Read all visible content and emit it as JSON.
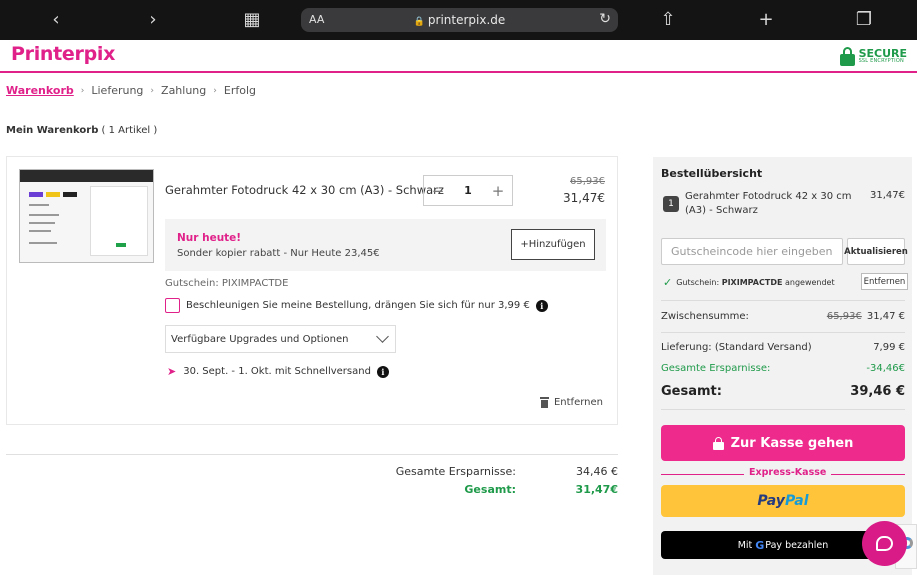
{
  "browser": {
    "aa_label": "AA",
    "url": "printerpix.de"
  },
  "header": {
    "logo": "Printerpix",
    "secure_main": "SECURE",
    "secure_sub": "SSL ENCRYPTION"
  },
  "breadcrumb": [
    "Warenkorb",
    "Lieferung",
    "Zahlung",
    "Erfolg"
  ],
  "cart": {
    "title": "Mein Warenkorb",
    "count": "( 1 Artikel )",
    "item": {
      "name": "Gerahmter Fotodruck 42 x 30 cm (A3) - Schwarz",
      "qty_minus": "−",
      "qty": "1",
      "qty_plus": "+",
      "price_old": "65,93€",
      "price_new": "31,47€"
    },
    "offer": {
      "title": "Nur heute!",
      "text": "Sonder kopier rabatt - Nur Heute 23,45€",
      "button": "+Hinzufügen"
    },
    "voucher": "Gutschein: PIXIMPACTDE",
    "express": "Beschleunigen Sie meine Bestellung, drängen Sie sich für nur 3,99 €",
    "upgrades": "Verfügbare Upgrades und Optionen",
    "delivery": "30. Sept. - 1. Okt. mit Schnellversand",
    "remove": "Entfernen"
  },
  "totals": {
    "savings_label": "Gesamte Ersparnisse:",
    "savings_value": "34,46 €",
    "total_label": "Gesamt:",
    "total_value": "31,47€"
  },
  "summary": {
    "title": "Bestellübersicht",
    "badge": "1",
    "item_name": "Gerahmter Fotodruck 42 x 30 cm (A3) - Schwarz",
    "item_price": "31,47€",
    "coupon_placeholder": "Gutscheincode hier eingeben",
    "coupon_button": "Aktualisieren",
    "coupon_applied_prefix": "Gutschein:",
    "coupon_applied_code": "PIXIMPACTDE",
    "coupon_applied_suffix": "angewendet",
    "coupon_remove": "Entfernen",
    "subtotal_label": "Zwischensumme:",
    "subtotal_old": "65,93€",
    "subtotal_new": "31,47 €",
    "shipping_label": "Lieferung: (Standard Versand)",
    "shipping_value": "7,99 €",
    "savings_label": "Gesamte Ersparnisse:",
    "savings_value": "-34,46€",
    "total_label": "Gesamt:",
    "total_value": "39,46 €",
    "checkout": "Zur Kasse gehen",
    "express_label": "Express-Kasse",
    "paypal_1": "Pay",
    "paypal_2": "Pal",
    "gpay_prefix": "Mit",
    "gpay_g": "G",
    "gpay_pay": "Pay",
    "gpay_suffix": "bezahlen"
  },
  "colors": {
    "brand": "#e0218a",
    "success": "#1f9a4a",
    "paypal_bg": "#ffc439"
  }
}
